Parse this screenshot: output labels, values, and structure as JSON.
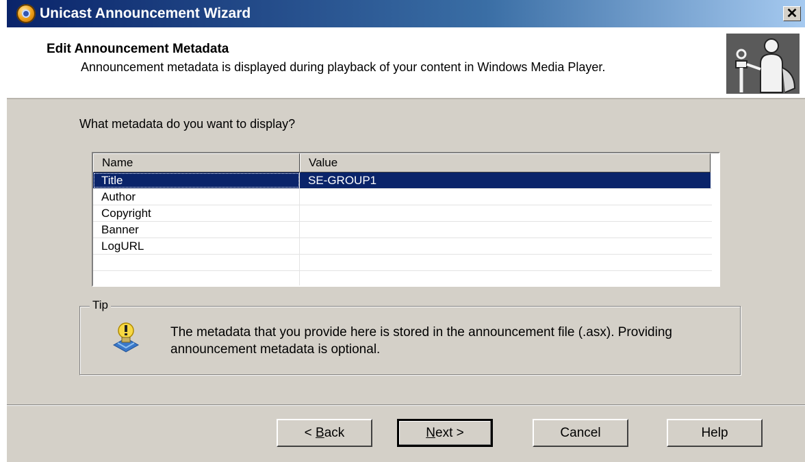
{
  "window": {
    "title": "Unicast Announcement Wizard",
    "close_symbol": "✕"
  },
  "header": {
    "title": "Edit Announcement Metadata",
    "description": "Announcement metadata is displayed during playback of your content in Windows Media Player."
  },
  "prompt": "What metadata do you want to display?",
  "list": {
    "columns": [
      "Name",
      "Value"
    ],
    "rows": [
      {
        "name": "Title",
        "value": "SE-GROUP1",
        "selected": true
      },
      {
        "name": "Author",
        "value": ""
      },
      {
        "name": "Copyright",
        "value": ""
      },
      {
        "name": "Banner",
        "value": ""
      },
      {
        "name": "LogURL",
        "value": ""
      }
    ]
  },
  "tip": {
    "label": "Tip",
    "text": "The metadata that you provide here is stored in the announcement file (.asx). Providing announcement metadata is optional."
  },
  "buttons": {
    "back": {
      "prefix": "< ",
      "mnemonic": "B",
      "rest": "ack"
    },
    "next": {
      "mnemonic": "N",
      "rest": "ext >"
    },
    "cancel": "Cancel",
    "help": "Help"
  },
  "colors": {
    "title_bar": "#0a246a",
    "selection": "#0a246a",
    "dialog_face": "#d4d0c8"
  }
}
